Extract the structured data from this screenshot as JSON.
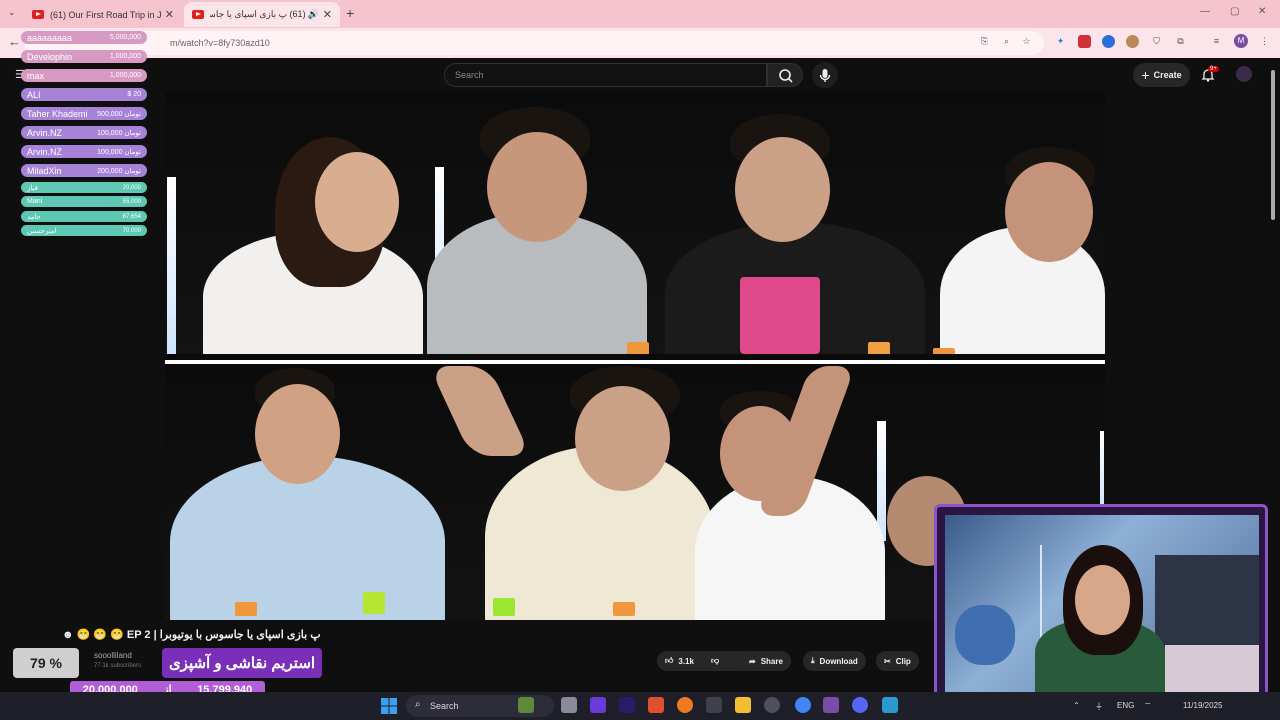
{
  "browser": {
    "tabs": [
      {
        "title": "(61) Our First Road Trip in Japa"
      },
      {
        "title": "(61) ﭖ بازی اسپای یا جاسوس"
      }
    ],
    "url": "m/watch?v=8fy730azd10"
  },
  "youtube": {
    "search_placeholder": "Search",
    "create_label": "Create",
    "notification_count": "9+"
  },
  "donations": [
    {
      "name": "aaaaaaaaa",
      "amount": "5,000,000",
      "color": "pink"
    },
    {
      "name": "Develophin",
      "amount": "1,000,000",
      "color": "pink"
    },
    {
      "name": "max",
      "amount": "1,000,000",
      "color": "pink"
    },
    {
      "name": "ALI",
      "amount": "$ 20",
      "color": "purple"
    },
    {
      "name": "Taher Khademi",
      "amount": "500,000 تومان",
      "color": "purple"
    },
    {
      "name": "Arvin.NZ",
      "amount": "100,000 تومان",
      "color": "purple"
    },
    {
      "name": "Arvin.NZ",
      "amount": "100,000 تومان",
      "color": "purple"
    },
    {
      "name": "MiladXin",
      "amount": "200,000 تومان",
      "color": "purple"
    },
    {
      "name": "فیاز",
      "amount": "20,000",
      "color": "teal"
    },
    {
      "name": "Mani",
      "amount": "55,000",
      "color": "teal"
    },
    {
      "name": "حامد",
      "amount": "87,654",
      "color": "teal"
    },
    {
      "name": "امیرحسین",
      "amount": "70,000",
      "color": "teal"
    }
  ],
  "video": {
    "title": "ﭖ بازی اسپای یا جاسوس با یوتیوبرا | EP 2 😁 😁 😁 ☻",
    "channel": "sooolliland",
    "subscribers": "77.1k subscribers",
    "likes": "3.1k",
    "share_label": "Share",
    "download_label": "Download",
    "clip_label": "Clip"
  },
  "overlay": {
    "progress_percent": "79 %",
    "stream_label": "استریم نقاشی و آشپزی",
    "goal_total": "20,000,000",
    "goal_separator": "از",
    "goal_current": "15,799,940"
  },
  "taskbar": {
    "search_label": "Search",
    "language": "ENG",
    "date": "11/19/2025"
  },
  "colors": {
    "tab_strip": "#f6c4cf",
    "overlay_purple": "#7a2fb8",
    "webcam_border": "#8a55c8"
  }
}
